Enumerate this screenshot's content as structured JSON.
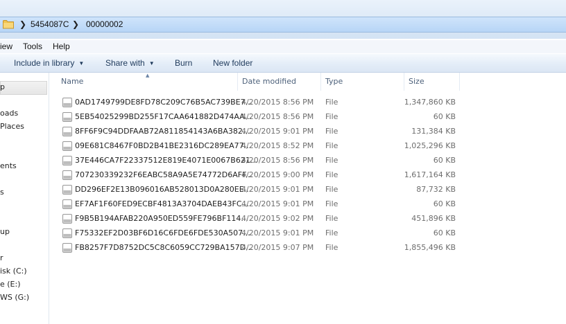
{
  "breadcrumb": {
    "items": [
      "5454087C",
      "00000002"
    ]
  },
  "menu": {
    "items": [
      "iew",
      "Tools",
      "Help"
    ]
  },
  "toolbar": {
    "include_in_library": "Include in library",
    "share_with": "Share with",
    "burn": "Burn",
    "new_folder": "New folder"
  },
  "nav_pane": {
    "items": [
      "p",
      "oads",
      "Places",
      "ents",
      "s",
      "up",
      "r",
      "isk (C:)",
      "e (E:)",
      "WS (G:)"
    ]
  },
  "columns": {
    "name": "Name",
    "date": "Date modified",
    "type": "Type",
    "size": "Size"
  },
  "files": [
    {
      "name": "0AD1749799DE8FD78C209C76B5AC739BE7...",
      "date": "4/20/2015 8:56 PM",
      "type": "File",
      "size": "1,347,860 KB"
    },
    {
      "name": "5EB54025299BD255F17CAA641882D474AA...",
      "date": "4/20/2015 8:56 PM",
      "type": "File",
      "size": "60 KB"
    },
    {
      "name": "8FF6F9C94DDFAAB72A811854143A6BA382...",
      "date": "4/20/2015 9:01 PM",
      "type": "File",
      "size": "131,384 KB"
    },
    {
      "name": "09E681C8467F0BD2B41BE2316DC289EA77...",
      "date": "4/20/2015 8:52 PM",
      "type": "File",
      "size": "1,025,296 KB"
    },
    {
      "name": "37E446CA7F22337512E819E4071E0067B621...",
      "date": "4/20/2015 8:56 PM",
      "type": "File",
      "size": "60 KB"
    },
    {
      "name": "707230339232F6EABC58A9A5E74772D6AFF...",
      "date": "4/20/2015 9:00 PM",
      "type": "File",
      "size": "1,617,164 KB"
    },
    {
      "name": "DD296EF2E13B096016AB528013D0A280EE...",
      "date": "4/20/2015 9:01 PM",
      "type": "File",
      "size": "87,732 KB"
    },
    {
      "name": "EF7AF1F60FED9ECBF4813A3704DAEB43FC...",
      "date": "4/20/2015 9:01 PM",
      "type": "File",
      "size": "60 KB"
    },
    {
      "name": "F9B5B194AFAB220A950ED559FE796BF114...",
      "date": "4/20/2015 9:02 PM",
      "type": "File",
      "size": "451,896 KB"
    },
    {
      "name": "F75332EF2D03BF6D16C6FDE6FDE530A507...",
      "date": "4/20/2015 9:01 PM",
      "type": "File",
      "size": "60 KB"
    },
    {
      "name": "FB8257F7D8752DC5C8C6059CC729BA157D...",
      "date": "4/20/2015 9:07 PM",
      "type": "File",
      "size": "1,855,496 KB"
    }
  ],
  "colors": {
    "address_bar": "#b7d5f6",
    "header_text": "#4c607a",
    "secondary_text": "#6d6d6d",
    "command_text": "#1e395b"
  },
  "icons": {
    "address": "folder-icon",
    "file": "generic-file-icon",
    "separator": "chevron-right-icon",
    "dropdown": "caret-down-icon"
  }
}
